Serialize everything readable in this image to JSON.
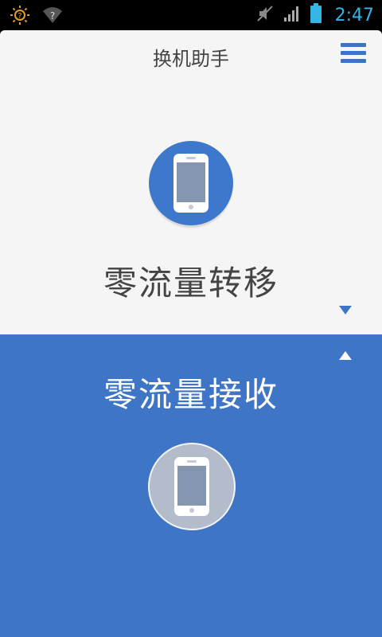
{
  "status_bar": {
    "time": "2:47",
    "icons": [
      "brightness-icon",
      "wifi-unknown-icon",
      "mute-icon",
      "signal-icon",
      "battery-icon"
    ]
  },
  "app": {
    "title": "换机助手",
    "menu_icon": "hamburger-menu-icon"
  },
  "send": {
    "label": "零流量转移",
    "circle_color": "#3e78cc",
    "arrow_icon": "chevron-down-icon"
  },
  "receive": {
    "label": "零流量接收",
    "circle_color": "#b2bccb",
    "panel_color": "#3f75c6",
    "arrow_icon": "chevron-up-icon"
  }
}
